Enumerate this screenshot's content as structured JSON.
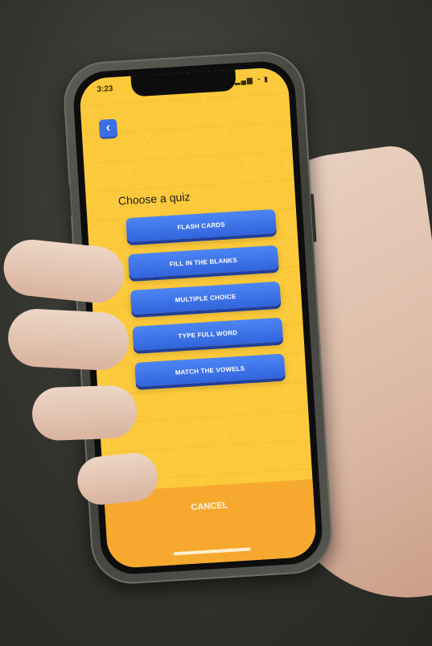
{
  "status_bar": {
    "time": "3:23",
    "icons_text": "▂▄▆ ◔ ▮"
  },
  "header": {
    "back_icon": "‹"
  },
  "main": {
    "title": "Choose a quiz",
    "quiz_options": [
      {
        "label": "FLASH CARDS"
      },
      {
        "label": "FILL IN THE BLANKS"
      },
      {
        "label": "MULTIPLE CHOICE"
      },
      {
        "label": "TYPE FULL WORD"
      },
      {
        "label": "MATCH THE VOWELS"
      }
    ]
  },
  "footer": {
    "cancel_label": "CANCEL"
  },
  "colors": {
    "background_yellow": "#fcc93a",
    "footer_orange": "#f6a92e",
    "button_blue": "#3a6fe8"
  },
  "icons": [
    "chevron-left-icon",
    "signal-icon",
    "wifi-icon",
    "battery-icon"
  ]
}
